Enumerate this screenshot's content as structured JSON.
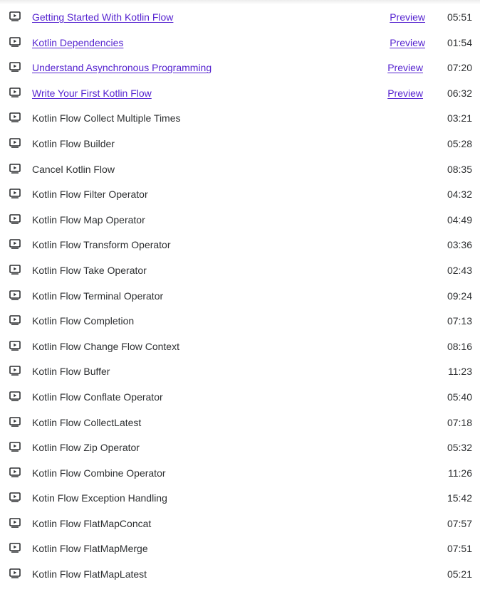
{
  "icon_name": "video-play-icon",
  "link_color": "#5624d0",
  "lectures": [
    {
      "title": "Getting Started With Kotlin Flow",
      "preview": "Preview",
      "duration": "05:51"
    },
    {
      "title": "Kotlin Dependencies",
      "preview": "Preview",
      "duration": "01:54"
    },
    {
      "title": "Understand Asynchronous Programming",
      "preview": "Preview",
      "duration": "07:20"
    },
    {
      "title": "Write Your First Kotlin Flow",
      "preview": "Preview",
      "duration": "06:32"
    },
    {
      "title": "Kotlin Flow Collect Multiple Times",
      "duration": "03:21"
    },
    {
      "title": "Kotlin Flow Builder",
      "duration": "05:28"
    },
    {
      "title": "Cancel Kotlin Flow",
      "duration": "08:35"
    },
    {
      "title": "Kotlin Flow Filter Operator",
      "duration": "04:32"
    },
    {
      "title": "Kotlin Flow Map Operator",
      "duration": "04:49"
    },
    {
      "title": "Kotlin Flow Transform Operator",
      "duration": "03:36"
    },
    {
      "title": "Kotlin Flow Take Operator",
      "duration": "02:43"
    },
    {
      "title": "Kotlin Flow Terminal Operator",
      "duration": "09:24"
    },
    {
      "title": "Kotlin Flow Completion",
      "duration": "07:13"
    },
    {
      "title": "Kotlin Flow Change Flow Context",
      "duration": "08:16"
    },
    {
      "title": "Kotlin Flow Buffer",
      "duration": "11:23"
    },
    {
      "title": "Kotlin Flow Conflate Operator",
      "duration": "05:40"
    },
    {
      "title": "Kotlin Flow CollectLatest",
      "duration": "07:18"
    },
    {
      "title": "Kotlin Flow Zip Operator",
      "duration": "05:32"
    },
    {
      "title": "Kotlin Flow Combine Operator",
      "duration": "11:26"
    },
    {
      "title": "Kotin Flow Exception Handling",
      "duration": "15:42"
    },
    {
      "title": "Kotlin Flow FlatMapConcat",
      "duration": "07:57"
    },
    {
      "title": "Kotlin Flow FlatMapMerge",
      "duration": "07:51"
    },
    {
      "title": "Kotlin Flow FlatMapLatest",
      "duration": "05:21"
    }
  ]
}
